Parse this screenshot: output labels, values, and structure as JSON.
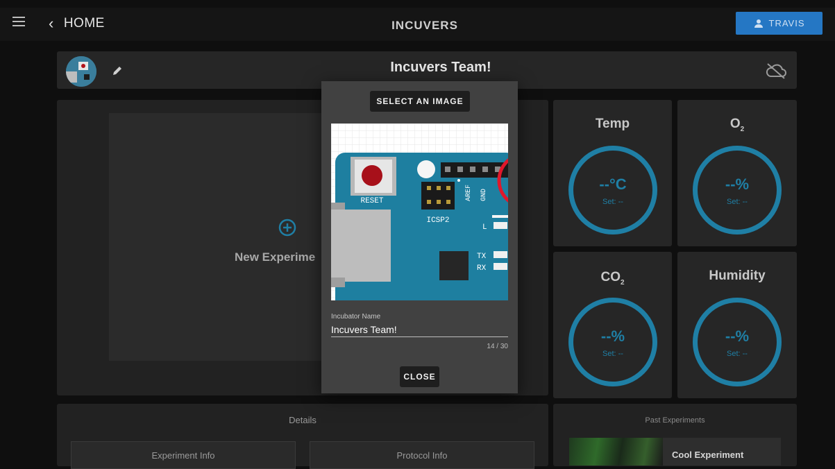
{
  "topbar": {
    "home_label": "HOME",
    "logo_text": "INCUVERS",
    "user_label": "TRAVIS"
  },
  "header": {
    "title": "Incuvers Team!"
  },
  "experiment": {
    "new_label": "New Experime"
  },
  "sensors": [
    {
      "title": "Temp",
      "value": "--°C",
      "set": "Set: --"
    },
    {
      "title": "O",
      "sub": "2",
      "value": "--%",
      "set": "Set: --"
    },
    {
      "title": "CO",
      "sub": "2",
      "value": "--%",
      "set": "Set: --"
    },
    {
      "title": "Humidity",
      "value": "--%",
      "set": "Set: --"
    }
  ],
  "details": {
    "title": "Details",
    "experiment_info": "Experiment Info",
    "protocol_info": "Protocol Info"
  },
  "past": {
    "title": "Past Experiments",
    "item_name": "Cool Experiment"
  },
  "modal": {
    "select_image_label": "SELECT AN IMAGE",
    "incubator_name_label": "Incubator Name",
    "incubator_name_value": "Incuvers Team!",
    "char_count": "14 / 30",
    "close_label": "CLOSE",
    "board": {
      "reset": "RESET",
      "icsp": "ICSP2",
      "aref": "AREF",
      "gnd": "GND",
      "l": "L",
      "tx": "TX",
      "rx": "RX"
    }
  },
  "colors": {
    "accent_blue": "#2577c4",
    "ring_blue": "#1f7fa5",
    "board_teal": "#1e7fa0"
  }
}
